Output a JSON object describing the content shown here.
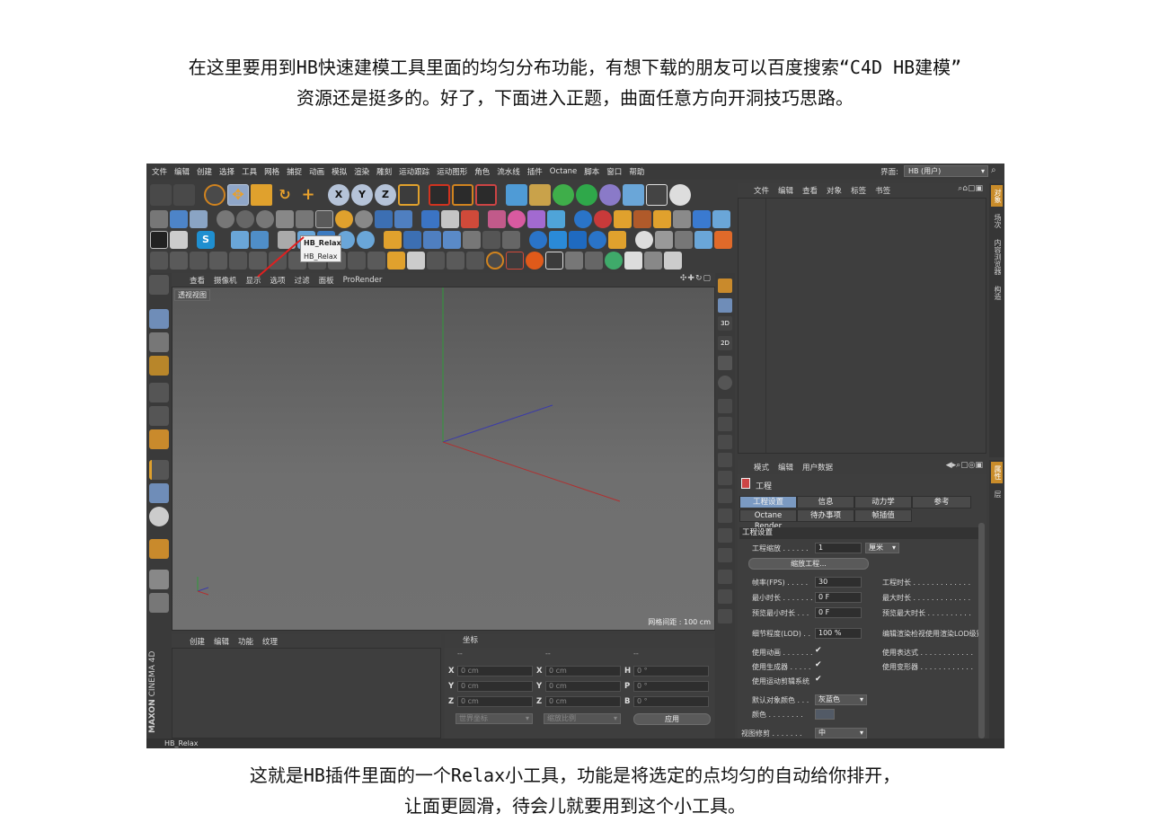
{
  "captions": {
    "top_line1": "在这里要用到HB快速建模工具里面的均匀分布功能，有想下载的朋友可以百度搜索“C4D HB建模”",
    "top_line2": "资源还是挺多的。好了，下面进入正题，曲面任意方向开洞技巧思路。",
    "bottom_line1": "这就是HB插件里面的一个Relax小工具，功能是将选定的点均匀的自动给你排开，",
    "bottom_line2": "让面更圆滑，待会儿就要用到这个小工具。"
  },
  "menubar": {
    "items": [
      "文件",
      "编辑",
      "创建",
      "选择",
      "工具",
      "网格",
      "捕捉",
      "动画",
      "模拟",
      "渲染",
      "雕刻",
      "运动跟踪",
      "运动图形",
      "角色",
      "流水线",
      "插件",
      "Octane",
      "脚本",
      "窗口",
      "帮助"
    ],
    "layout_label": "界面:",
    "layout_value": "HB (用户)"
  },
  "toolbar": {
    "axis_x": "X",
    "axis_y": "Y",
    "axis_z": "Z",
    "s_label": "S"
  },
  "tooltip": {
    "title": "HB_Relax",
    "subtitle": "HB_Relax"
  },
  "viewport": {
    "menu": [
      "查看",
      "摄像机",
      "显示",
      "选项",
      "过滤",
      "面板",
      "ProRender"
    ],
    "label": "透视视图",
    "grid_spacing": "网格间距 : 100 cm"
  },
  "right_column": {
    "labels": [
      "3D",
      "2D"
    ]
  },
  "object_manager": {
    "menu": [
      "文件",
      "编辑",
      "查看",
      "对象",
      "标签",
      "书签"
    ],
    "side_tabs": [
      "对象",
      "场次",
      "内容浏览器",
      "构造"
    ]
  },
  "attributes": {
    "menu": [
      "模式",
      "编辑",
      "用户数据"
    ],
    "side_tabs": [
      "属性",
      "层"
    ],
    "title": "工程",
    "tabs_row1": [
      "工程设置",
      "信息",
      "动力学",
      "参考"
    ],
    "tabs_row2": [
      "Octane Render",
      "待办事项",
      "帧插值"
    ],
    "section": "工程设置",
    "scale_label": "工程缩放 . . . . . .",
    "scale_value": "1",
    "scale_unit": "厘米",
    "scale_button": "缩放工程...",
    "fps_label": "帧率(FPS) . . . . .",
    "fps_value": "30",
    "min_time_label": "最小时长 . . . . . . .",
    "min_time_value": "0 F",
    "preview_min_label": "预览最小时长 . . .",
    "preview_min_value": "0 F",
    "project_time_label": "工程时长 . . . . . . . . . . . . .",
    "max_time_label": "最大时长 . . . . . . . . . . . . .",
    "preview_max_label": "预览最大时长 . . . . . . . . . .",
    "lod_label": "细节程度(LOD) . .",
    "lod_value": "100 %",
    "render_lod_label": "编辑渲染检视使用渲染LOD级别",
    "use_anim_label": "使用动画 . . . . . . .",
    "use_gen_label": "使用生成器 . . . . .",
    "use_motion_label": "使用运动剪辑系统",
    "use_expr_label": "使用表达式 . . . . . . . . . . . .",
    "use_deform_label": "使用变形器 . . . . . . . . . . . .",
    "check": "✔",
    "default_color_label": "默认对象颜色 . . .",
    "default_color_value": "灰蓝色",
    "color_label": "颜色 . . . . . . . .",
    "view_clip_label": "视图修剪 . . . . . . .",
    "view_clip_value": "中"
  },
  "materials": {
    "menu": [
      "创建",
      "编辑",
      "功能",
      "纹理"
    ]
  },
  "coordinates": {
    "title": "坐标",
    "dash": "--",
    "rows": [
      {
        "a": "X",
        "av": "0 cm",
        "b": "X",
        "bv": "0 cm",
        "c": "H",
        "cv": "0 °"
      },
      {
        "a": "Y",
        "av": "0 cm",
        "b": "Y",
        "bv": "0 cm",
        "c": "P",
        "cv": "0 °"
      },
      {
        "a": "Z",
        "av": "0 cm",
        "b": "Z",
        "bv": "0 cm",
        "c": "B",
        "cv": "0 °"
      }
    ],
    "world": "世界坐标",
    "scale": "缩放比例",
    "apply": "应用"
  },
  "brand": {
    "maxon": "MAXON",
    "cinema": "CINEMA 4D"
  },
  "status": "HB_Relax",
  "colors": {
    "accent_orange": "#d0831f",
    "selected_blue": "#7b9ac2",
    "axis_x": "#b03030",
    "axis_y": "#2f9a3a",
    "axis_z": "#3b3ba8"
  }
}
